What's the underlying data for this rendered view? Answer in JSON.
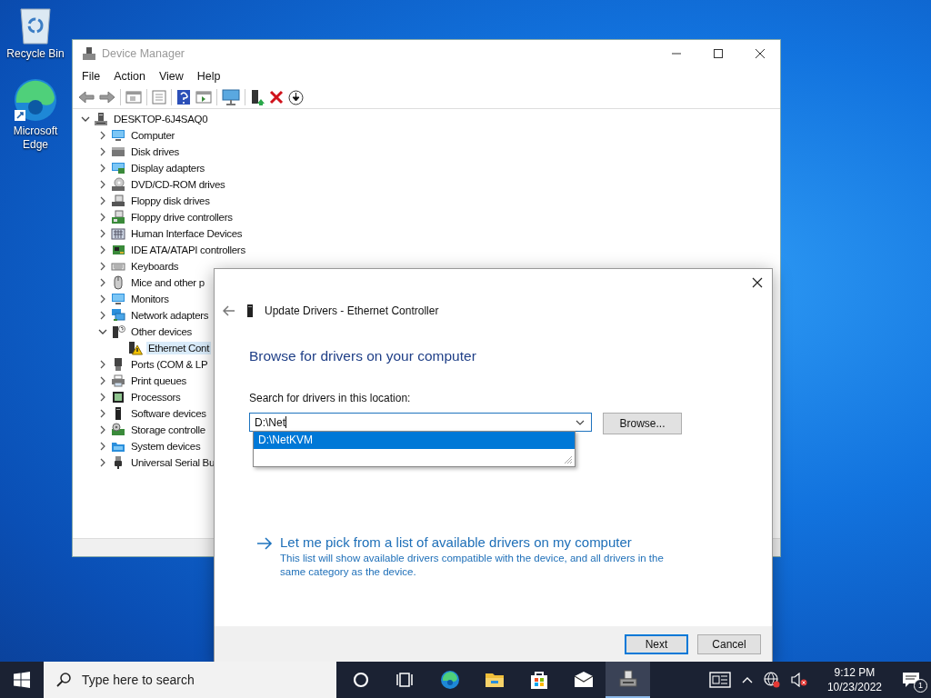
{
  "desktop_icons": [
    {
      "label": "Recycle Bin",
      "kind": "recycle"
    },
    {
      "label": "Microsoft Edge",
      "kind": "edge"
    }
  ],
  "device_manager": {
    "title": "Device Manager",
    "menu": [
      "File",
      "Action",
      "View",
      "Help"
    ],
    "tree": [
      {
        "label": "DESKTOP-6J4SAQ0",
        "kind": "root",
        "expanded": true,
        "selected": false,
        "children": [
          {
            "label": "Computer",
            "kind": "computer",
            "expanded": false,
            "selected": false
          },
          {
            "label": "Disk drives",
            "kind": "disk",
            "expanded": false,
            "selected": false
          },
          {
            "label": "Display adapters",
            "kind": "display",
            "expanded": false,
            "selected": false
          },
          {
            "label": "DVD/CD-ROM drives",
            "kind": "dvd",
            "expanded": false,
            "selected": false
          },
          {
            "label": "Floppy disk drives",
            "kind": "floppy",
            "expanded": false,
            "selected": false
          },
          {
            "label": "Floppy drive controllers",
            "kind": "floppyctl",
            "expanded": false,
            "selected": false
          },
          {
            "label": "Human Interface Devices",
            "kind": "hid",
            "expanded": false,
            "selected": false
          },
          {
            "label": "IDE ATA/ATAPI controllers",
            "kind": "ide",
            "expanded": false,
            "selected": false
          },
          {
            "label": "Keyboards",
            "kind": "keyboard",
            "expanded": false,
            "selected": false
          },
          {
            "label": "Mice and other p",
            "kind": "mouse",
            "expanded": false,
            "selected": false
          },
          {
            "label": "Monitors",
            "kind": "monitor",
            "expanded": false,
            "selected": false
          },
          {
            "label": "Network adapters",
            "kind": "network",
            "expanded": false,
            "selected": false
          },
          {
            "label": "Other devices",
            "kind": "other",
            "expanded": true,
            "selected": false,
            "children": [
              {
                "label": "Ethernet Cont",
                "kind": "warning",
                "selected": true
              }
            ]
          },
          {
            "label": "Ports (COM & LP",
            "kind": "ports",
            "expanded": false,
            "selected": false
          },
          {
            "label": "Print queues",
            "kind": "print",
            "expanded": false,
            "selected": false
          },
          {
            "label": "Processors",
            "kind": "processor",
            "expanded": false,
            "selected": false
          },
          {
            "label": "Software devices",
            "kind": "software",
            "expanded": false,
            "selected": false
          },
          {
            "label": "Storage controlle",
            "kind": "storage",
            "expanded": false,
            "selected": false
          },
          {
            "label": "System devices",
            "kind": "system",
            "expanded": false,
            "selected": false
          },
          {
            "label": "Universal Serial Bu",
            "kind": "usb",
            "expanded": false,
            "selected": false
          }
        ]
      }
    ]
  },
  "dialog": {
    "title": "Update Drivers - Ethernet Controller",
    "heading": "Browse for drivers on your computer",
    "location_label": "Search for drivers in this location:",
    "location_value": "D:\\Net",
    "suggestions": [
      {
        "label": "D:\\NetKVM",
        "selected": true
      }
    ],
    "browse_button": "Browse...",
    "pick_link": "Let me pick from a list of available drivers on my computer",
    "pick_description": "This list will show available drivers compatible with the device, and all drivers in the same category as the device.",
    "buttons": [
      {
        "label": "Next",
        "default": true
      },
      {
        "label": "Cancel",
        "default": false
      }
    ]
  },
  "taskbar": {
    "search_placeholder": "Type here to search",
    "apps": [
      {
        "kind": "cortana",
        "active": false
      },
      {
        "kind": "taskview",
        "active": false
      },
      {
        "kind": "edge",
        "active": false
      },
      {
        "kind": "explorer",
        "active": false
      },
      {
        "kind": "store",
        "active": false
      },
      {
        "kind": "mail",
        "active": false
      },
      {
        "kind": "devmgr",
        "active": true
      }
    ],
    "time": "9:12 PM",
    "date": "10/23/2022",
    "notification_count": "1"
  }
}
